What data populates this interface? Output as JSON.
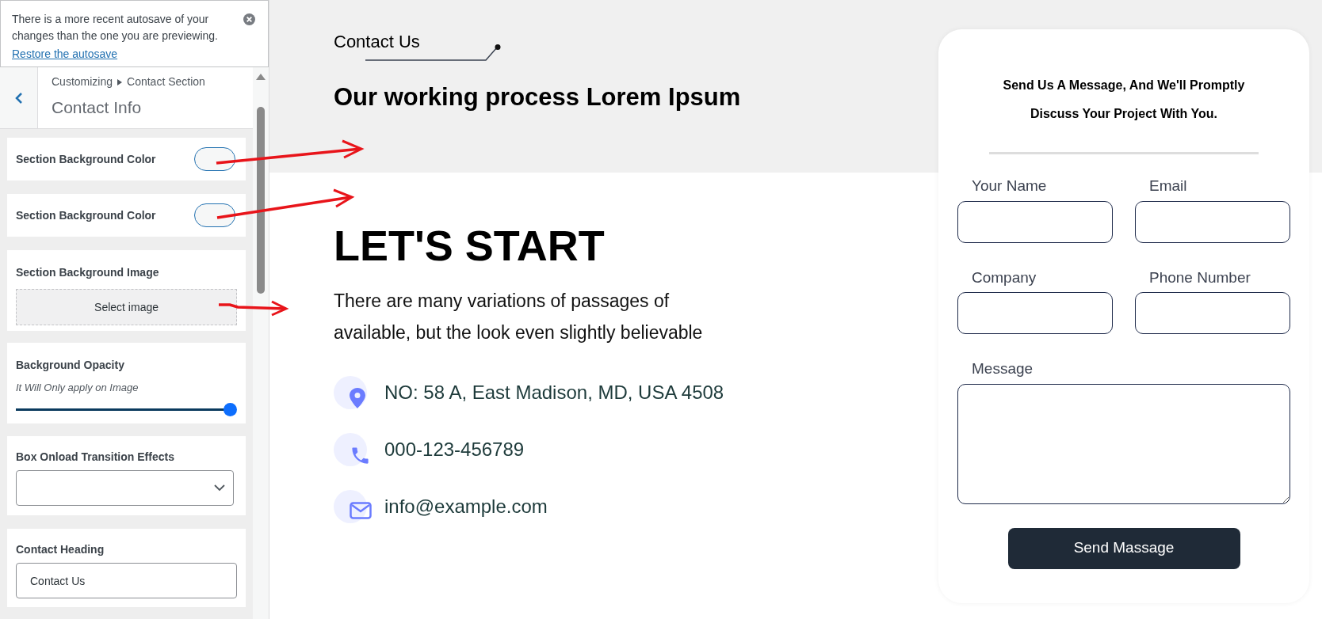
{
  "notice": {
    "text": "There is a more recent autosave of your changes than the one you are previewing.",
    "link": "Restore the autosave"
  },
  "header": {
    "breadcrumb": [
      "Customizing",
      "Contact Section"
    ],
    "title": "Contact Info"
  },
  "controls": [
    {
      "kind": "color",
      "label": "Section Background Color"
    },
    {
      "kind": "color",
      "label": "Section Background Color"
    },
    {
      "kind": "image",
      "label": "Section Background Image",
      "button": "Select image"
    },
    {
      "kind": "slider",
      "label": "Background Opacity",
      "description": "It Will Only apply on Image",
      "level": 1
    },
    {
      "kind": "select",
      "label": "Box Onload Transition Effects"
    },
    {
      "kind": "text",
      "label": "Contact Heading",
      "value": "Contact Us"
    }
  ],
  "preview": {
    "eyebrow": "Contact Us",
    "heading": "Our working process Lorem Ipsum",
    "title": "LET'S START",
    "paragraph": "There are many variations of passages of available, but the look even slightly believable",
    "contacts": [
      {
        "kind": "location",
        "text": "NO: 58 A, East Madison, MD, USA 4508"
      },
      {
        "kind": "phone",
        "text": "000-123-456789"
      },
      {
        "kind": "email",
        "text": "info@example.com"
      }
    ],
    "form": {
      "title": "Send Us A Message, And We'll Promptly Discuss Your Project With You.",
      "fields": [
        {
          "kind": "input",
          "label": "Your Name"
        },
        {
          "kind": "input",
          "label": "Email"
        },
        {
          "kind": "input",
          "label": "Company"
        },
        {
          "kind": "input",
          "label": "Phone Number"
        },
        {
          "kind": "textarea",
          "label": "Message"
        }
      ],
      "submit": "Send Massage"
    }
  }
}
